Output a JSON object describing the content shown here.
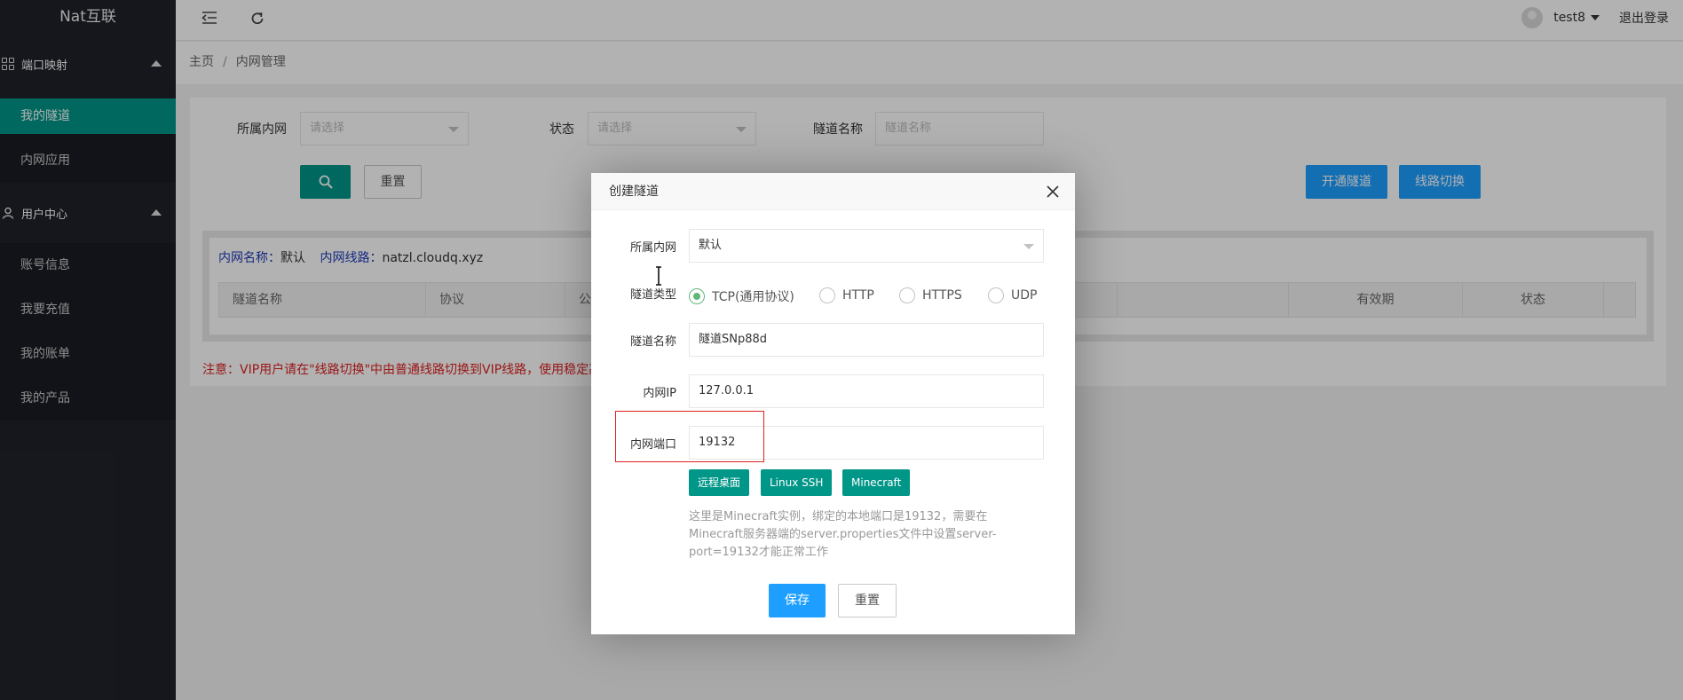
{
  "app": {
    "logo": "Nat互联"
  },
  "sidebar": {
    "groups": [
      {
        "label": "端口映射",
        "items": [
          "我的隧道",
          "内网应用"
        ]
      },
      {
        "label": "用户中心",
        "items": [
          "账号信息",
          "我要充值",
          "我的账单",
          "我的产品"
        ]
      }
    ],
    "active_item": "我的隧道"
  },
  "header": {
    "username": "test8",
    "logout": "退出登录"
  },
  "breadcrumb": {
    "home": "主页",
    "sep": "/",
    "current": "内网管理"
  },
  "filters": {
    "network_label": "所属内网",
    "network_placeholder": "请选择",
    "status_label": "状态",
    "status_placeholder": "请选择",
    "name_label": "隧道名称",
    "name_placeholder": "隧道名称",
    "reset": "重置",
    "open_tunnel": "开通隧道",
    "switch_line": "线路切换"
  },
  "info": {
    "network_key": "内网名称：",
    "network_val": "默认",
    "line_key": "内网线路：",
    "line_val": "natzl.cloudq.xyz"
  },
  "table": {
    "columns": [
      "隧道名称",
      "协议",
      "公",
      "有效期",
      "状态"
    ]
  },
  "notice": "注意：VIP用户请在\"线路切换\"中由普通线路切换到VIP线路，使用稳定高",
  "modal": {
    "title": "创建隧道",
    "network_label": "所属内网",
    "network_value": "默认",
    "type_label": "隧道类型",
    "types": [
      "TCP(通用协议)",
      "HTTP",
      "HTTPS",
      "UDP"
    ],
    "selected_type": "TCP(通用协议)",
    "name_label": "隧道名称",
    "name_value": "隧道SNp88d",
    "ip_label": "内网IP",
    "ip_value": "127.0.0.1",
    "port_label": "内网端口",
    "port_value": "19132",
    "presets": [
      "远程桌面",
      "Linux SSH",
      "Minecraft"
    ],
    "hint": "这里是Minecraft实例，绑定的本地端口是19132，需要在Minecraft服务器端的server.properties文件中设置server-port=19132才能正常工作",
    "save": "保存",
    "reset": "重置"
  },
  "colors": {
    "sidebar_bg": "#20222a",
    "active_bg": "#009688",
    "primary_blue": "#1e9fff",
    "radio_on": "#5FB878",
    "alert_red": "#e02020"
  }
}
